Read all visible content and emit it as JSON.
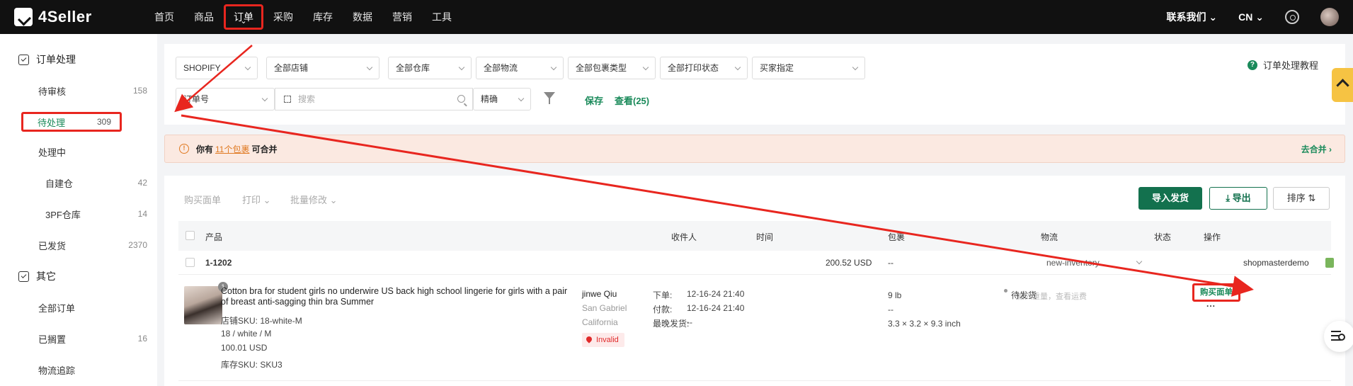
{
  "app": {
    "logo": "4Seller"
  },
  "nav": {
    "items": [
      "首页",
      "商品",
      "订单",
      "采购",
      "库存",
      "数据",
      "营销",
      "工具"
    ],
    "contact": "联系我们 ⌄",
    "lang": "CN ⌄"
  },
  "sidebar": {
    "group1": "订单处理",
    "pending_review": {
      "label": "待审核",
      "count": "158"
    },
    "to_process": {
      "label": "待处理",
      "count": "309"
    },
    "processing": {
      "label": "处理中"
    },
    "self_warehouse": {
      "label": "自建仓",
      "count": "42"
    },
    "tpf_warehouse": {
      "label": "3PF仓库",
      "count": "14"
    },
    "shipped": {
      "label": "已发货",
      "count": "2370"
    },
    "group2": "其它",
    "all_orders": {
      "label": "全部订单"
    },
    "on_hold": {
      "label": "已搁置",
      "count": "16"
    },
    "tracking": {
      "label": "物流追踪"
    }
  },
  "filters": {
    "platform": "SHOPIFY",
    "store": "全部店铺",
    "warehouse": "全部仓库",
    "logistics": "全部物流",
    "package_type": "全部包裹类型",
    "print_status": "全部打印状态",
    "buyer_specified": "买家指定",
    "search_field": "订单号",
    "search_placeholder": "搜索",
    "match_mode": "精确",
    "save": "保存",
    "view": "查看(25)",
    "tutorial": "订单处理教程"
  },
  "notice": {
    "prefix": "你有",
    "link": "11个包裹",
    "suffix": "可合并",
    "action": "去合并 ›"
  },
  "toolbar": {
    "buy_label": "购买面单",
    "print": "打印 ⌄",
    "batch_edit": "批量修改 ⌄",
    "import_ship": "导入发货",
    "export": "⤓ 导出",
    "sort": "排序 ⇅"
  },
  "table": {
    "headers": [
      "产品",
      "收件人",
      "时间",
      "包裹",
      "物流",
      "状态",
      "操作"
    ],
    "group": {
      "order_id": "1-1202",
      "amount": "200.52 USD",
      "package": "--",
      "logistics": "new-inventory",
      "shop": "shopmasterdemo"
    },
    "row": {
      "img_count": "1",
      "title": "Cotton bra for student girls no underwire US back high school lingerie for girls with a pair of breast anti-sagging thin bra Summer",
      "store_sku": "店铺SKU: 18-white-M",
      "variant": "18 / white / M",
      "price": "100.01 USD",
      "stock_sku": "库存SKU: SKU3",
      "recipient_name": "jinwe Qiu",
      "recipient_city": "San Gabriel",
      "recipient_state": "California",
      "invalid_tag": "Invalid",
      "time_order_label": "下单:",
      "time_order": "12-16-24 21:40",
      "time_paid_label": "付款:",
      "time_paid": "12-16-24 21:40",
      "time_latest_label": "最晚发货:",
      "time_latest": "--",
      "weight": "9 lb",
      "pkg_dash": "--",
      "dims": "3.3 × 3.2 × 9.3 inch",
      "logistics_hint": "输入重量，查看运费",
      "status": "待发货",
      "action": "购买面单",
      "more": "..."
    }
  },
  "colors": {
    "accent": "#13714e",
    "highlight": "#e8261f",
    "warning": "#e07a22"
  }
}
